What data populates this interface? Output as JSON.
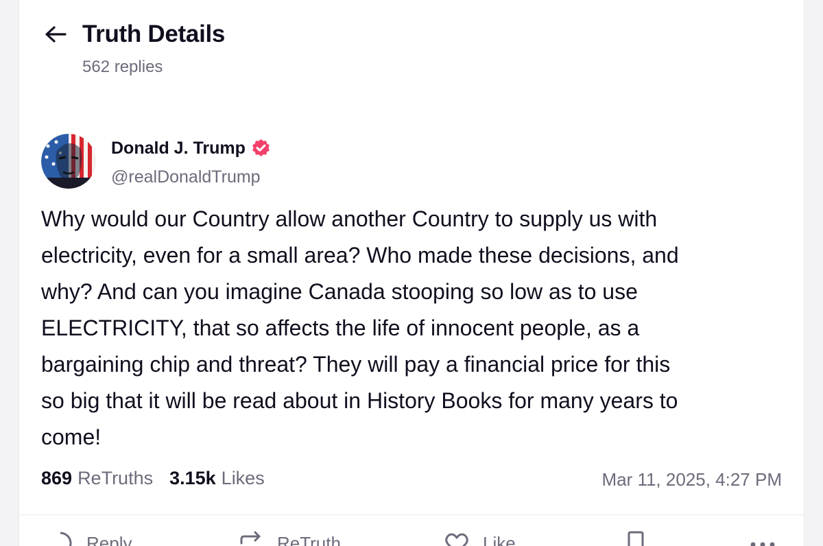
{
  "header": {
    "title": "Truth Details",
    "replies": "562 replies"
  },
  "post": {
    "author": {
      "name": "Donald J. Trump",
      "handle": "@realDonaldTrump",
      "verified_icon": "verified-badge-icon",
      "verified_color": "#f2416b"
    },
    "body": "Why would our Country allow another Country to supply us with\nelectricity, even for a small area? Who made these decisions, and\nwhy? And can you imagine Canada stooping so low as to use\nELECTRICITY, that so affects the life of innocent people, as a\nbargaining chip and threat? They will pay a financial price for this\nso big that it will be read about in History Books for many years to\ncome!",
    "stats": {
      "retruths_count": "869",
      "retruths_label": "ReTruths",
      "likes_count": "3.15k",
      "likes_label": "Likes"
    },
    "timestamp": "Mar 11, 2025, 4:27 PM"
  },
  "actions": {
    "reply_label": "Reply",
    "retruth_label": "ReTruth",
    "like_label": "Like"
  },
  "colors": {
    "text": "#0f0f1e",
    "muted": "#6b6b7b",
    "accent": "#f2416b"
  }
}
